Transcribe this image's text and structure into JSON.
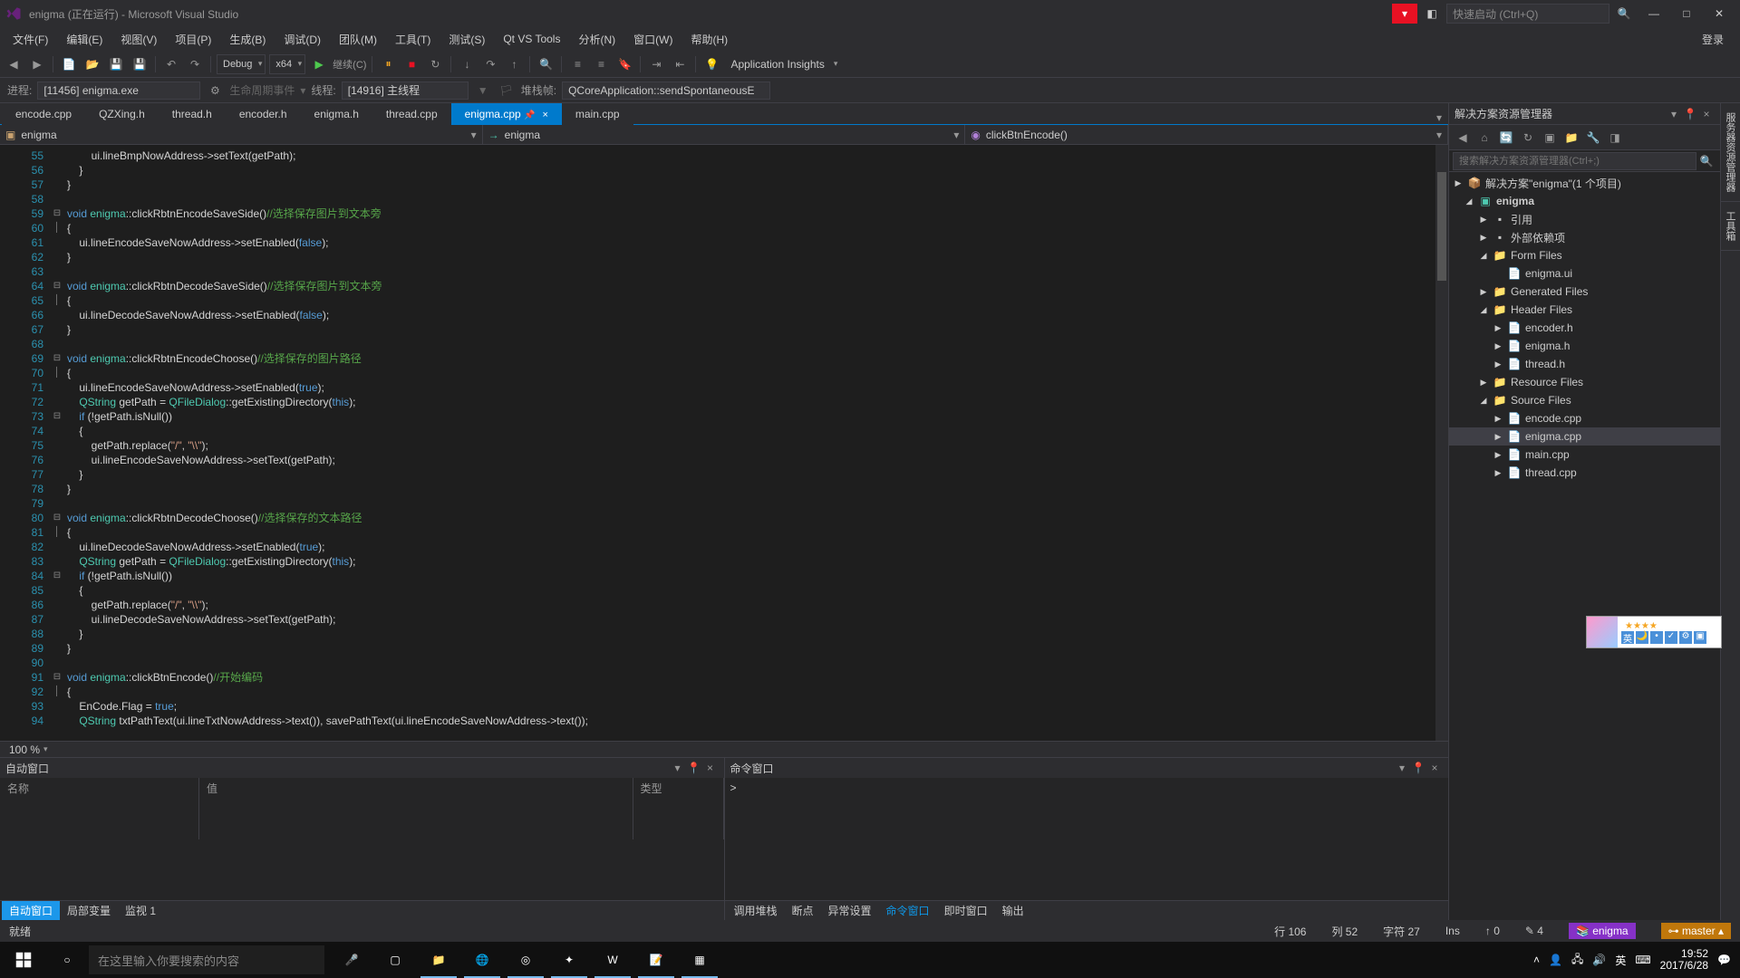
{
  "title": "enigma (正在运行) - Microsoft Visual Studio",
  "quicklaunch": "快速启动 (Ctrl+Q)",
  "menu": [
    "文件(F)",
    "编辑(E)",
    "视图(V)",
    "项目(P)",
    "生成(B)",
    "调试(D)",
    "团队(M)",
    "工具(T)",
    "测试(S)",
    "Qt VS Tools",
    "分析(N)",
    "窗口(W)",
    "帮助(H)"
  ],
  "login": "登录",
  "toolbar": {
    "config": "Debug",
    "platform": "x64",
    "continue": "继续(C)",
    "ai": "Application Insights"
  },
  "debugbar": {
    "process_label": "进程:",
    "process": "[11456] enigma.exe",
    "lifecycle": "生命周期事件",
    "thread_label": "线程:",
    "thread": "[14916] 主线程",
    "stack": "堆栈帧:",
    "frame": "QCoreApplication::sendSpontaneousE"
  },
  "tabs": [
    "encode.cpp",
    "QZXing.h",
    "thread.h",
    "encoder.h",
    "enigma.h",
    "thread.cpp",
    "enigma.cpp",
    "main.cpp"
  ],
  "active_tab": 6,
  "nav": {
    "scope": "enigma",
    "class": "enigma",
    "member": "clickBtnEncode()"
  },
  "lines_start": 55,
  "lines_end": 94,
  "zoom": "100 %",
  "autos": {
    "title": "自动窗口",
    "cols": [
      "名称",
      "值",
      "类型"
    ]
  },
  "autos_tabs": [
    "自动窗口",
    "局部变量",
    "监视 1"
  ],
  "cmd": {
    "title": "命令窗口",
    "prompt": ">"
  },
  "cmd_tabs": [
    "调用堆栈",
    "断点",
    "异常设置",
    "命令窗口",
    "即时窗口",
    "输出"
  ],
  "solution": {
    "title": "解决方案资源管理器",
    "search": "搜索解决方案资源管理器(Ctrl+;)",
    "root": "解决方案\"enigma\"(1 个项目)",
    "project": "enigma",
    "refs": "引用",
    "ext": "外部依赖项",
    "forms": "Form Files",
    "form_items": [
      "enigma.ui"
    ],
    "gen": "Generated Files",
    "headers": "Header Files",
    "header_items": [
      "encoder.h",
      "enigma.h",
      "thread.h"
    ],
    "res": "Resource Files",
    "sources": "Source Files",
    "source_items": [
      "encode.cpp",
      "enigma.cpp",
      "main.cpp",
      "thread.cpp"
    ],
    "selected": "enigma.cpp"
  },
  "rightvtabs": [
    "服务器资源管理器",
    "工具箱"
  ],
  "status": {
    "ready": "就绪",
    "line": "行 106",
    "col": "列 52",
    "char": "字符 27",
    "ins": "Ins",
    "up": "0",
    "changes": "4",
    "repo": "enigma",
    "branch": "master"
  },
  "taskbar": {
    "search": "在这里输入你要搜索的内容",
    "time": "19:52",
    "date": "2017/6/28"
  }
}
